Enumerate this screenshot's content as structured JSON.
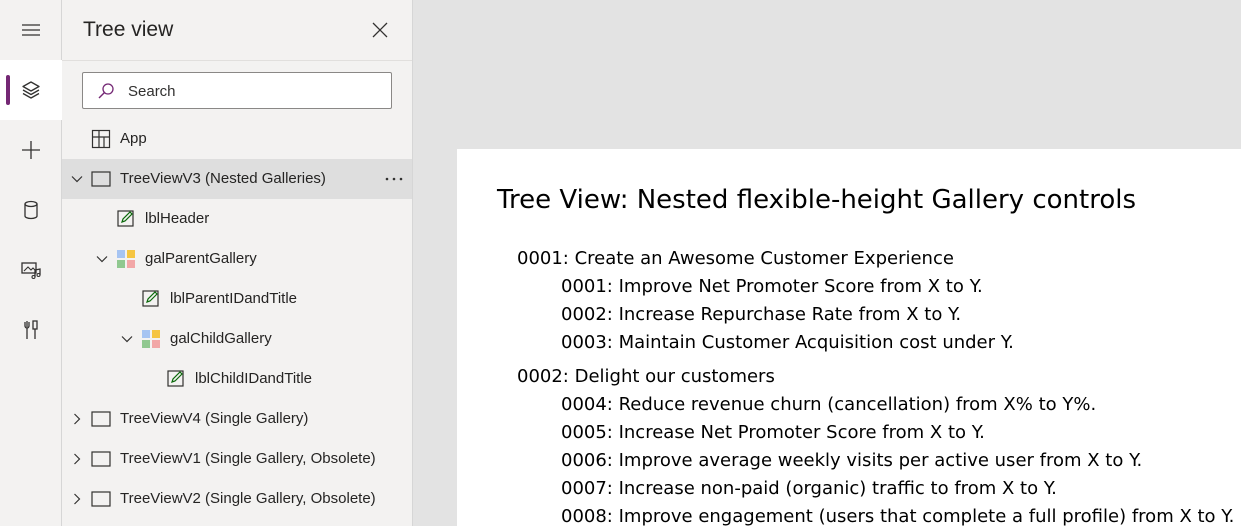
{
  "rail": {
    "items": [
      {
        "icon": "hamburger-menu-icon",
        "active": false
      },
      {
        "icon": "layers-icon",
        "active": true
      },
      {
        "icon": "plus-icon",
        "active": false
      },
      {
        "icon": "database-icon",
        "active": false
      },
      {
        "icon": "media-icon",
        "active": false
      },
      {
        "icon": "tools-icon",
        "active": false
      }
    ],
    "accent": "#742774"
  },
  "panel": {
    "title": "Tree view",
    "search_placeholder": "Search",
    "items": [
      {
        "label": "App",
        "icon": "app-icon",
        "expander": "none",
        "selected": false
      },
      {
        "label": "TreeViewV3 (Nested Galleries)",
        "icon": "screen-icon",
        "expander": "expanded",
        "selected": true
      },
      {
        "label": "lblHeader",
        "icon": "label-icon",
        "expander": "none",
        "selected": false
      },
      {
        "label": "galParentGallery",
        "icon": "gallery-icon",
        "expander": "expanded",
        "selected": false
      },
      {
        "label": "lblParentIDandTitle",
        "icon": "label-icon",
        "expander": "none",
        "selected": false
      },
      {
        "label": "galChildGallery",
        "icon": "gallery-icon",
        "expander": "expanded",
        "selected": false
      },
      {
        "label": "lblChildIDandTitle",
        "icon": "label-icon",
        "expander": "none",
        "selected": false
      },
      {
        "label": "TreeViewV4 (Single Gallery)",
        "icon": "screen-icon",
        "expander": "collapsed",
        "selected": false
      },
      {
        "label": "TreeViewV1 (Single Gallery, Obsolete)",
        "icon": "screen-icon",
        "expander": "collapsed",
        "selected": false
      },
      {
        "label": "TreeViewV2 (Single Gallery, Obsolete)",
        "icon": "screen-icon",
        "expander": "collapsed",
        "selected": false
      }
    ]
  },
  "canvas": {
    "title": "Tree View: Nested flexible-height Gallery controls",
    "lines": [
      {
        "kind": "parent",
        "text": "0001: Create an Awesome Customer Experience"
      },
      {
        "kind": "child",
        "text": "0001: Improve Net Promoter Score from X to Y."
      },
      {
        "kind": "child",
        "text": "0002: Increase Repurchase Rate from X to Y."
      },
      {
        "kind": "child",
        "text": "0003: Maintain Customer Acquisition cost under Y."
      },
      {
        "kind": "parent",
        "text": "0002: Delight our customers"
      },
      {
        "kind": "child",
        "text": "0004: Reduce revenue churn (cancellation) from X% to Y%."
      },
      {
        "kind": "child",
        "text": "0005: Increase Net Promoter Score from X to Y."
      },
      {
        "kind": "child",
        "text": "0006: Improve average weekly visits per active user from X to Y."
      },
      {
        "kind": "child",
        "text": "0007: Increase non-paid (organic) traffic to from X to Y."
      },
      {
        "kind": "child",
        "text": "0008: Improve engagement (users that complete a full profile) from X to Y."
      }
    ]
  }
}
